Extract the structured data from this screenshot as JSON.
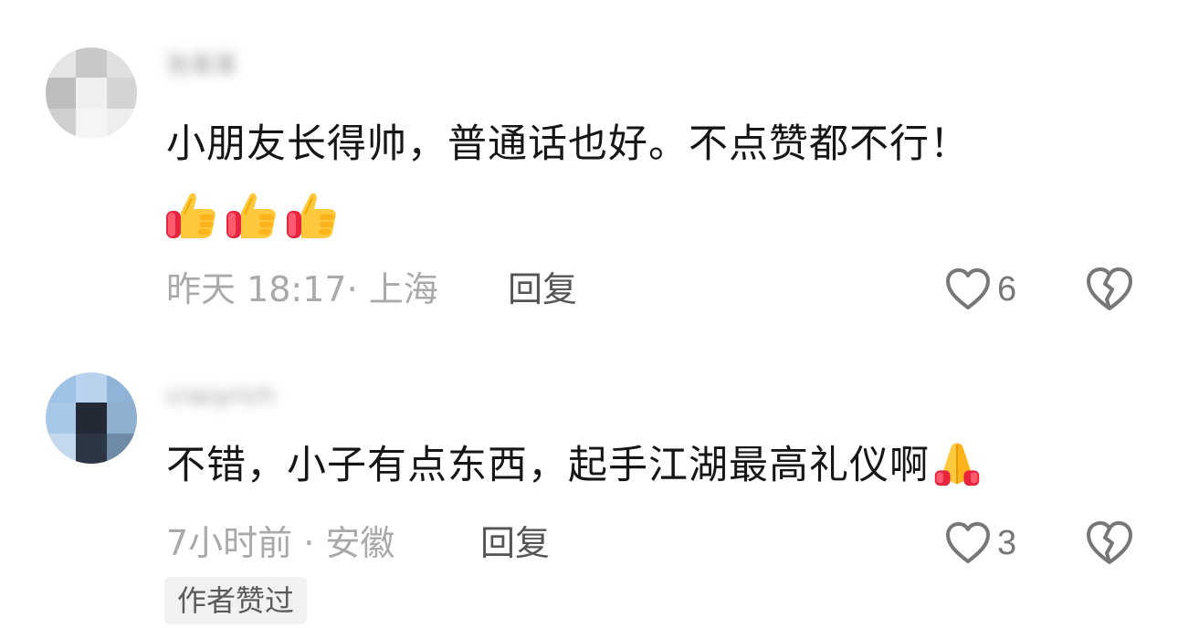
{
  "comments": [
    {
      "username": "张某某",
      "text": "小朋友长得帅，普通话也好。不点赞都不行！",
      "emojis": [
        "thumbs-up",
        "thumbs-up",
        "thumbs-up"
      ],
      "meta": "昨天 18:17· 上海",
      "reply_label": "回复",
      "like_count": "6",
      "avatar_colors": [
        "#e6e6e6",
        "#c8c8c8",
        "#e0e0e0",
        "#bdbdbd",
        "#f0f0f0",
        "#d4d4d4",
        "#cfcfcf",
        "#f5f5f5",
        "#ededed"
      ]
    },
    {
      "username": "crazyrich",
      "text": "不错，小子有点东西，起手江湖最高礼仪啊",
      "emojis": [
        "folded-hands"
      ],
      "meta": "7小时前 · 安徽",
      "reply_label": "回复",
      "like_count": "3",
      "badge": "作者赞过",
      "avatar_colors": [
        "#9ec3e6",
        "#b9d3ee",
        "#8fb4d8",
        "#a8c8e8",
        "#232a36",
        "#8fb0cf",
        "#c4d8ee",
        "#2c3644",
        "#6f8aa6"
      ]
    }
  ],
  "icons": {
    "like": "heart-outline-icon",
    "dislike": "broken-heart-icon",
    "thumbs_up": "thumbs-up-emoji",
    "folded_hands": "folded-hands-emoji"
  },
  "colors": {
    "text_primary": "#161616",
    "text_meta": "#a9a9a9",
    "reply": "#555555",
    "icon_gray": "#777777",
    "badge_bg": "#f1f1f1"
  }
}
